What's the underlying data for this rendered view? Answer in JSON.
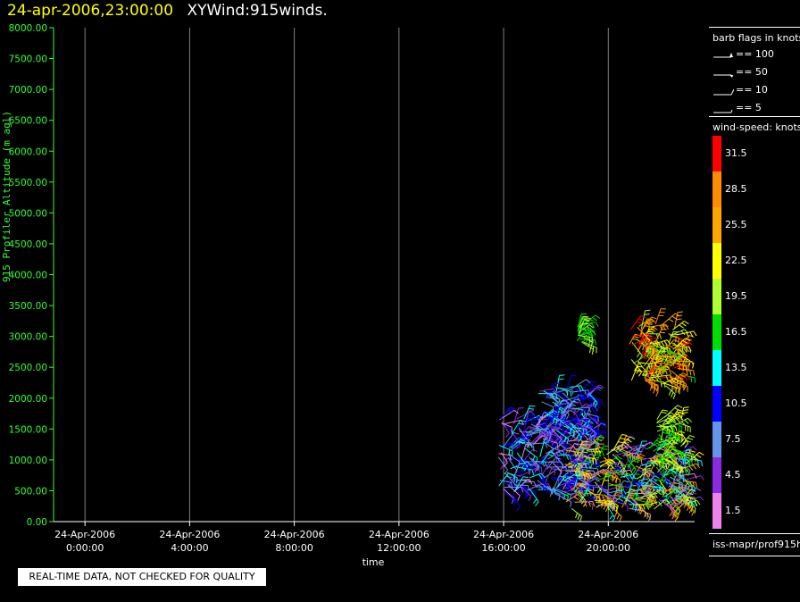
{
  "header": {
    "timestamp": "24-apr-2006,23:00:00",
    "title": "XYWind:915winds."
  },
  "chart_data": {
    "type": "scatter",
    "subtype": "wind-barb time-height plot",
    "ylabel": "915 Profiler Altitude (m agl)",
    "xlabel": "time",
    "ylim": [
      0,
      8000
    ],
    "yticks": [
      "0.00",
      "500.00",
      "1000.00",
      "1500.00",
      "2000.00",
      "2500.00",
      "3000.00",
      "3500.00",
      "4000.00",
      "4500.00",
      "5000.00",
      "5500.00",
      "6000.00",
      "6500.00",
      "7000.00",
      "7500.00",
      "8000.00"
    ],
    "xlim_hours": [
      -1.2,
      23.3
    ],
    "xticks": [
      {
        "hour": 0,
        "date": "24-Apr-2006",
        "time": "0:00:00"
      },
      {
        "hour": 4,
        "date": "24-Apr-2006",
        "time": "4:00:00"
      },
      {
        "hour": 8,
        "date": "24-Apr-2006",
        "time": "8:00:00"
      },
      {
        "hour": 12,
        "date": "24-Apr-2006",
        "time": "12:00:00"
      },
      {
        "hour": 16,
        "date": "24-Apr-2006",
        "time": "16:00:00"
      },
      {
        "hour": 20,
        "date": "24-Apr-2006",
        "time": "20:00:00"
      }
    ],
    "grid": true,
    "data_clusters": [
      {
        "hour_start": 15.8,
        "hour_end": 19.2,
        "alt_min": 450,
        "alt_max": 1700,
        "speed_range_knots": [
          1.5,
          13.5
        ]
      },
      {
        "hour_start": 17.3,
        "hour_end": 19.3,
        "alt_min": 1500,
        "alt_max": 2200,
        "speed_range_knots": [
          4.5,
          13.5
        ]
      },
      {
        "hour_start": 18.3,
        "hour_end": 23.0,
        "alt_min": 200,
        "alt_max": 1200,
        "speed_range_knots": [
          1.5,
          28.5
        ]
      },
      {
        "hour_start": 20.8,
        "hour_end": 22.7,
        "alt_min": 2200,
        "alt_max": 3200,
        "speed_range_knots": [
          16.5,
          31.5
        ]
      },
      {
        "hour_start": 18.8,
        "hour_end": 19.0,
        "alt_min": 2900,
        "alt_max": 3200,
        "speed_range_knots": [
          16.5,
          19.5
        ]
      },
      {
        "hour_start": 21.8,
        "hour_end": 22.8,
        "alt_min": 1000,
        "alt_max": 1700,
        "speed_range_knots": [
          16.5,
          22.5
        ]
      }
    ]
  },
  "barb_legend": {
    "title": "barb flags in knots",
    "items": [
      "== 100",
      "== 50",
      "== 10",
      "== 5"
    ]
  },
  "colorbar": {
    "title": "wind-speed: knots",
    "levels": [
      {
        "label": "31.5",
        "color": "#ff0000"
      },
      {
        "label": "28.5",
        "color": "#ff8c00"
      },
      {
        "label": "25.5",
        "color": "#ffa500"
      },
      {
        "label": "22.5",
        "color": "#ffff00"
      },
      {
        "label": "19.5",
        "color": "#adff2f"
      },
      {
        "label": "16.5",
        "color": "#00dd00"
      },
      {
        "label": "13.5",
        "color": "#00ffff"
      },
      {
        "label": "10.5",
        "color": "#0000ff"
      },
      {
        "label": "7.5",
        "color": "#6495ed"
      },
      {
        "label": "4.5",
        "color": "#8a2be2"
      },
      {
        "label": "1.5",
        "color": "#ee82ee"
      }
    ]
  },
  "footer": {
    "source": "iss-mapr/prof915h"
  },
  "notice": "REAL-TIME DATA, NOT CHECKED FOR QUALITY",
  "colors": {
    "axis": "#33ff33",
    "grid": "#808080",
    "header_timestamp": "#ffff00"
  }
}
